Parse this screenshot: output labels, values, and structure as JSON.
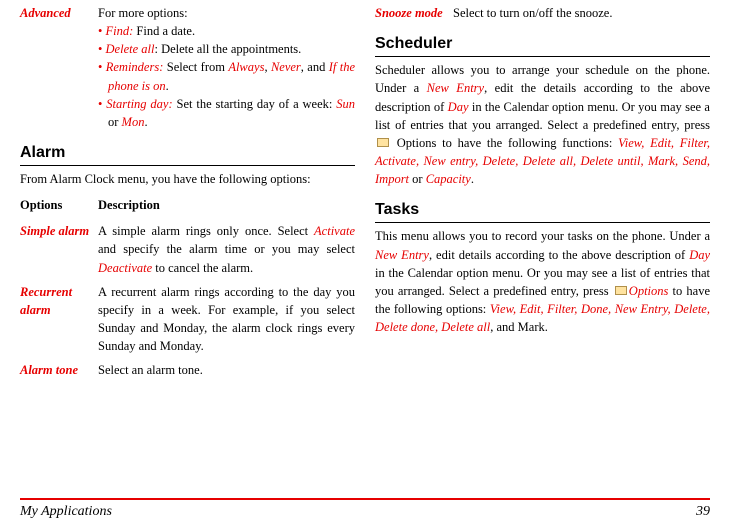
{
  "left": {
    "advanced": {
      "label": "Advanced",
      "intro": "For more options:",
      "find_key": "Find:",
      "find_rest": " Find a date.",
      "deleteall_key": "Delete all",
      "deleteall_rest": ": Delete all the appointments.",
      "rem_key": "Reminders:",
      "rem_mid1": " Select from ",
      "rem_always": "Always",
      "rem_comma": ", ",
      "rem_never": "Never",
      "rem_and": ", and ",
      "rem_ifon": "If the phone is on",
      "rem_period": ".",
      "start_key": "Starting day:",
      "start_mid": " Set the starting day of a week: ",
      "start_sun": "Sun",
      "start_or": " or ",
      "start_mon": "Mon",
      "start_period": "."
    },
    "alarm_heading": "Alarm",
    "alarm_intro": "From Alarm Clock menu, you have the following options:",
    "th_options": "Options",
    "th_desc": "Description",
    "simple": {
      "label": "Simple alarm",
      "t1": "A simple alarm rings only once. Select ",
      "activate": "Activate",
      "t2": " and specify the alarm time or you may select ",
      "deactivate": "Deactivate",
      "t3": " to cancel the alarm."
    },
    "recurrent": {
      "label": "Recurrent alarm",
      "text": "A recurrent alarm rings according to the day you specify in a week. For example, if you select Sunday and Monday, the alarm clock rings every Sunday and Monday."
    },
    "tone": {
      "label": "Alarm tone",
      "text": "Select an alarm tone."
    }
  },
  "right": {
    "snooze": {
      "label": "Snooze mode",
      "text": "Select to turn on/off the snooze."
    },
    "sched_heading": "Scheduler",
    "sched": {
      "t1": "Scheduler allows you to arrange your schedule on the phone. Under a ",
      "newentry": "New Entry",
      "t2": ", edit the details according to the above description of ",
      "day": "Day",
      "t3": " in the Calendar option menu. Or you may see a list of entries that you arranged. Select a predefined entry, press ",
      "t4": " Options to have the following functions: ",
      "funcs": "View, Edit, Filter, Activate, New entry, Delete, Delete all, Delete until, Mark, Send, Import",
      "or": " or ",
      "capacity": "Capacity",
      "period": "."
    },
    "tasks_heading": "Tasks",
    "tasks": {
      "t1": "This menu allows you to record your tasks on the phone. Under a ",
      "newentry": "New Entry",
      "t2": ", edit details according to the above description of ",
      "day": "Day",
      "t3": " in the Calendar option menu. Or you may see a list of entries that you arranged. Select a predefined entry, press ",
      "options": "Options",
      "t4": " to have the following options: ",
      "funcs": "View, Edit, Filter, Done, New Entry, Delete, Delete done, Delete all",
      "t5": ", and Mark."
    }
  },
  "footer": {
    "title": "My Applications",
    "page": "39"
  }
}
